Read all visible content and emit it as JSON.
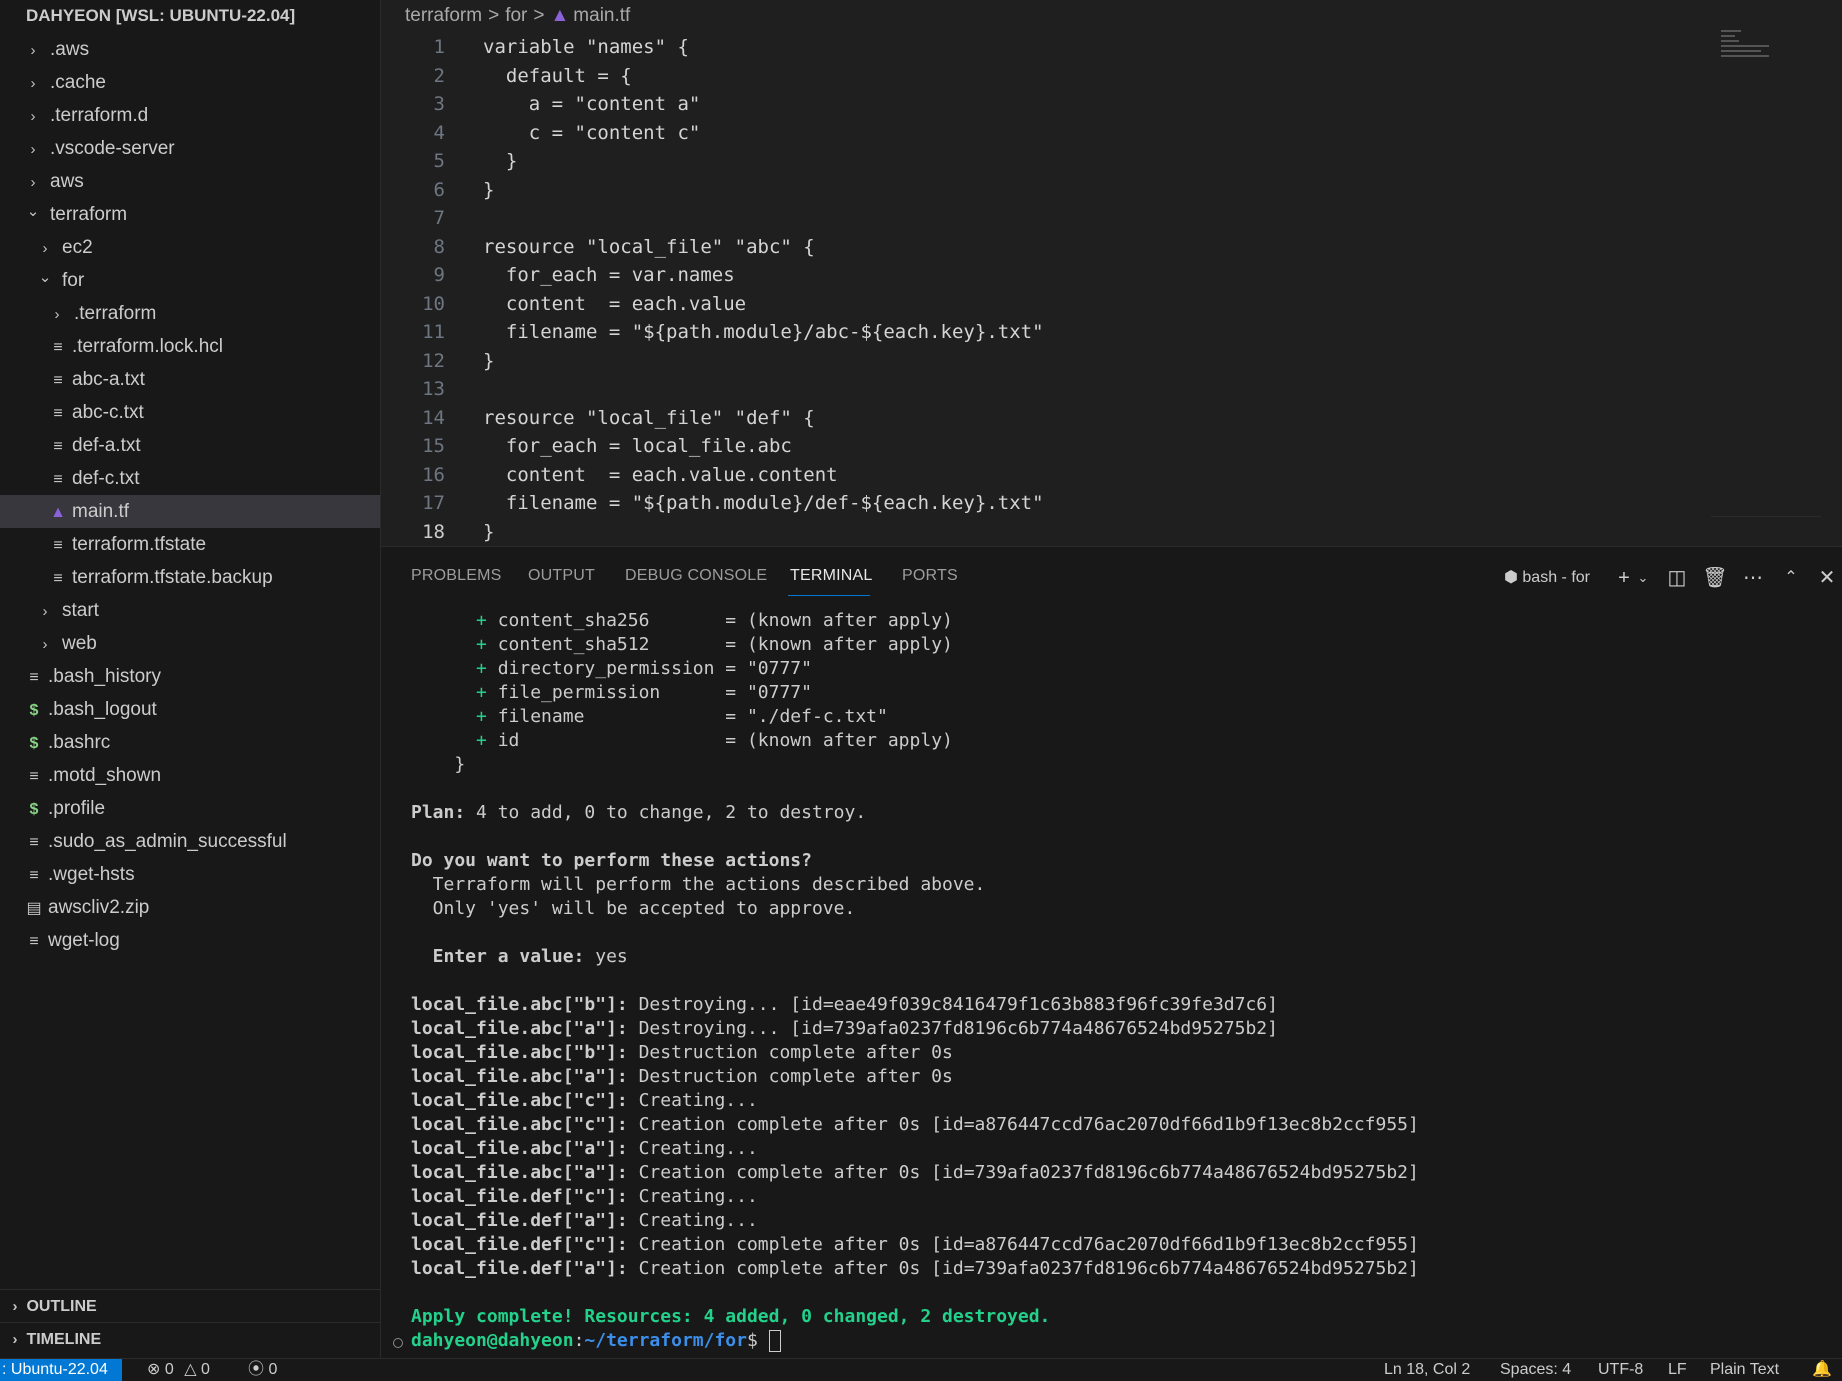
{
  "sidebar": {
    "title": "DAHYEON [WSL: UBUNTU-22.04]",
    "items": [
      {
        "label": ".aws",
        "kind": "folder",
        "open": false,
        "depth": 0
      },
      {
        "label": ".cache",
        "kind": "folder",
        "open": false,
        "depth": 0
      },
      {
        "label": ".terraform.d",
        "kind": "folder",
        "open": false,
        "depth": 0
      },
      {
        "label": ".vscode-server",
        "kind": "folder",
        "open": false,
        "depth": 0
      },
      {
        "label": "aws",
        "kind": "folder",
        "open": false,
        "depth": 0
      },
      {
        "label": "terraform",
        "kind": "folder",
        "open": true,
        "depth": 0
      },
      {
        "label": "ec2",
        "kind": "folder",
        "open": false,
        "depth": 1
      },
      {
        "label": "for",
        "kind": "folder",
        "open": true,
        "depth": 1
      },
      {
        "label": ".terraform",
        "kind": "folder",
        "open": false,
        "depth": 2
      },
      {
        "label": ".terraform.lock.hcl",
        "kind": "file",
        "depth": 2
      },
      {
        "label": "abc-a.txt",
        "kind": "file",
        "depth": 2
      },
      {
        "label": "abc-c.txt",
        "kind": "file",
        "depth": 2
      },
      {
        "label": "def-a.txt",
        "kind": "file",
        "depth": 2
      },
      {
        "label": "def-c.txt",
        "kind": "file",
        "depth": 2
      },
      {
        "label": "main.tf",
        "kind": "tf",
        "depth": 2,
        "active": true
      },
      {
        "label": "terraform.tfstate",
        "kind": "file",
        "depth": 2
      },
      {
        "label": "terraform.tfstate.backup",
        "kind": "file",
        "depth": 2
      },
      {
        "label": "start",
        "kind": "folder",
        "open": false,
        "depth": 1
      },
      {
        "label": "web",
        "kind": "folder",
        "open": false,
        "depth": 1
      },
      {
        "label": ".bash_history",
        "kind": "file",
        "depth": 0
      },
      {
        "label": ".bash_logout",
        "kind": "shell",
        "depth": 0
      },
      {
        "label": ".bashrc",
        "kind": "shell",
        "depth": 0
      },
      {
        "label": ".motd_shown",
        "kind": "file",
        "depth": 0
      },
      {
        "label": ".profile",
        "kind": "shell",
        "depth": 0
      },
      {
        "label": ".sudo_as_admin_successful",
        "kind": "file",
        "depth": 0
      },
      {
        "label": ".wget-hsts",
        "kind": "file",
        "depth": 0
      },
      {
        "label": "awscliv2.zip",
        "kind": "zip",
        "depth": 0
      },
      {
        "label": "wget-log",
        "kind": "file",
        "depth": 0
      }
    ],
    "outline": "OUTLINE",
    "timeline": "TIMELINE"
  },
  "breadcrumb": [
    "terraform",
    "for",
    "main.tf"
  ],
  "editor": {
    "current_line": 18,
    "lines": [
      "variable \"names\" {",
      "  default = {",
      "    a = \"content a\"",
      "    c = \"content c\"",
      "  }",
      "}",
      "",
      "resource \"local_file\" \"abc\" {",
      "  for_each = var.names",
      "  content  = each.value",
      "  filename = \"${path.module}/abc-${each.key}.txt\"",
      "}",
      "",
      "resource \"local_file\" \"def\" {",
      "  for_each = local_file.abc",
      "  content  = each.value.content",
      "  filename = \"${path.module}/def-${each.key}.txt\"",
      "}"
    ]
  },
  "panel": {
    "tabs": [
      "PROBLEMS",
      "OUTPUT",
      "DEBUG CONSOLE",
      "TERMINAL",
      "PORTS"
    ],
    "active_tab": "TERMINAL",
    "terminal_name": "bash - for"
  },
  "terminal": {
    "lines": [
      {
        "text": "      + content_sha256       = (known after apply)",
        "style": "plus"
      },
      {
        "text": "      + content_sha512       = (known after apply)",
        "style": "plus"
      },
      {
        "text": "      + directory_permission = \"0777\"",
        "style": "plus"
      },
      {
        "text": "      + file_permission      = \"0777\"",
        "style": "plus"
      },
      {
        "text": "      + filename             = \"./def-c.txt\"",
        "style": "plus"
      },
      {
        "text": "      + id                   = (known after apply)",
        "style": "plus"
      },
      {
        "text": "    }",
        "style": "normal"
      },
      {
        "text": "",
        "style": "normal"
      },
      {
        "text": "Plan: 4 to add, 0 to change, 2 to destroy.",
        "style": "plan"
      },
      {
        "text": "",
        "style": "normal"
      },
      {
        "text": "Do you want to perform these actions?",
        "style": "bold"
      },
      {
        "text": "  Terraform will perform the actions described above.",
        "style": "normal"
      },
      {
        "text": "  Only 'yes' will be accepted to approve.",
        "style": "normal"
      },
      {
        "text": "",
        "style": "normal"
      },
      {
        "text": "  Enter a value: yes",
        "style": "enter"
      },
      {
        "text": "",
        "style": "normal"
      },
      {
        "text": "local_file.abc[\"b\"]: Destroying... [id=eae49f039c8416479f1c63b883f96fc39fe3d7c6]",
        "style": "res"
      },
      {
        "text": "local_file.abc[\"a\"]: Destroying... [id=739afa0237fd8196c6b774a48676524bd95275b2]",
        "style": "res"
      },
      {
        "text": "local_file.abc[\"b\"]: Destruction complete after 0s",
        "style": "res"
      },
      {
        "text": "local_file.abc[\"a\"]: Destruction complete after 0s",
        "style": "res"
      },
      {
        "text": "local_file.abc[\"c\"]: Creating...",
        "style": "res"
      },
      {
        "text": "local_file.abc[\"c\"]: Creation complete after 0s [id=a876447ccd76ac2070df66d1b9f13ec8b2ccf955]",
        "style": "res"
      },
      {
        "text": "local_file.abc[\"a\"]: Creating...",
        "style": "res"
      },
      {
        "text": "local_file.abc[\"a\"]: Creation complete after 0s [id=739afa0237fd8196c6b774a48676524bd95275b2]",
        "style": "res"
      },
      {
        "text": "local_file.def[\"c\"]: Creating...",
        "style": "res"
      },
      {
        "text": "local_file.def[\"a\"]: Creating...",
        "style": "res"
      },
      {
        "text": "local_file.def[\"c\"]: Creation complete after 0s [id=a876447ccd76ac2070df66d1b9f13ec8b2ccf955]",
        "style": "res"
      },
      {
        "text": "local_file.def[\"a\"]: Creation complete after 0s [id=739afa0237fd8196c6b774a48676524bd95275b2]",
        "style": "res"
      },
      {
        "text": "",
        "style": "normal"
      },
      {
        "text": "Apply complete! Resources: 4 added, 0 changed, 2 destroyed.",
        "style": "success"
      }
    ],
    "prompt_user": "dahyeon@dahyeon",
    "prompt_path": "~/terraform/for",
    "prompt_symbol": "$ "
  },
  "statusbar": {
    "remote": ": Ubuntu-22.04",
    "errors": "0",
    "warnings": "0",
    "ports": "0",
    "position": "Ln 18, Col 2",
    "spaces": "Spaces: 4",
    "encoding": "UTF-8",
    "eol": "LF",
    "language": "Plain Text"
  },
  "colors": {
    "accent": "#0078d4",
    "terminal_green": "#23d18b",
    "terminal_blue": "#3b8eea",
    "terraform_purple": "#8b63d8"
  }
}
